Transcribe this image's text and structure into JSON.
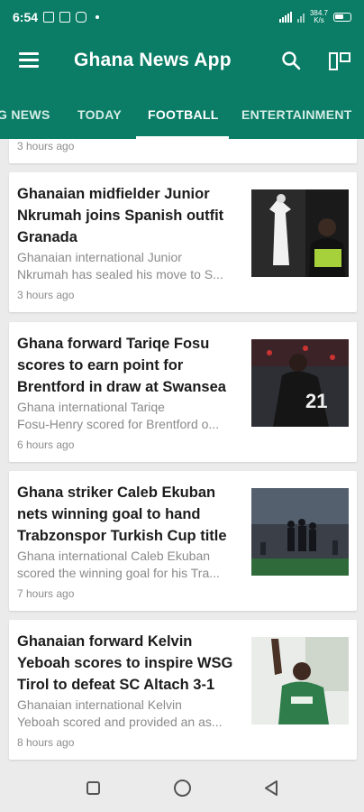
{
  "status_bar": {
    "time": "6:54",
    "net_speed_value": "384.7",
    "net_speed_unit": "K/s"
  },
  "app_bar": {
    "title": "Ghana News App"
  },
  "tabs": [
    {
      "label": "G NEWS",
      "active": false
    },
    {
      "label": "TODAY",
      "active": false
    },
    {
      "label": "FOOTBALL",
      "active": true
    },
    {
      "label": "ENTERTAINMENT",
      "active": false
    }
  ],
  "partial_card": {
    "time": "3 hours ago"
  },
  "articles": [
    {
      "title_lines": [
        "Ghanaian midfielder Junior",
        "Nkrumah joins Spanish outfit",
        "Granada"
      ],
      "desc_lines": [
        "Ghanaian international Junior",
        "Nkrumah has sealed his move to S..."
      ],
      "time": "3 hours ago",
      "thumb": "player-granada-photo"
    },
    {
      "title_lines": [
        "Ghana forward Tariqe Fosu",
        "scores to earn point for",
        "Brentford in draw at Swansea"
      ],
      "desc_lines": [
        "Ghana international Tariqe",
        "Fosu-Henry scored for Brentford o..."
      ],
      "time": "6 hours ago",
      "thumb": "player-brentford-photo"
    },
    {
      "title_lines": [
        "Ghana striker Caleb Ekuban",
        "nets winning goal to hand",
        "Trabzonspor Turkish Cup title"
      ],
      "desc_lines": [
        "Ghana international Caleb Ekuban",
        "scored the winning goal for his Tra..."
      ],
      "time": "7 hours ago",
      "thumb": "team-celebration-photo"
    },
    {
      "title_lines": [
        "Ghanaian forward Kelvin",
        "Yeboah scores to inspire WSG",
        "Tirol to defeat SC Altach 3-1"
      ],
      "desc_lines": [
        "Ghanaian international Kelvin",
        "Yeboah scored and provided an as..."
      ],
      "time": "8 hours ago",
      "thumb": "player-tirol-photo"
    }
  ],
  "colors": {
    "primary": "#0b7d66",
    "background": "#ebebeb",
    "title_text": "#1c1c1c",
    "muted_text": "#8a8a8a"
  }
}
